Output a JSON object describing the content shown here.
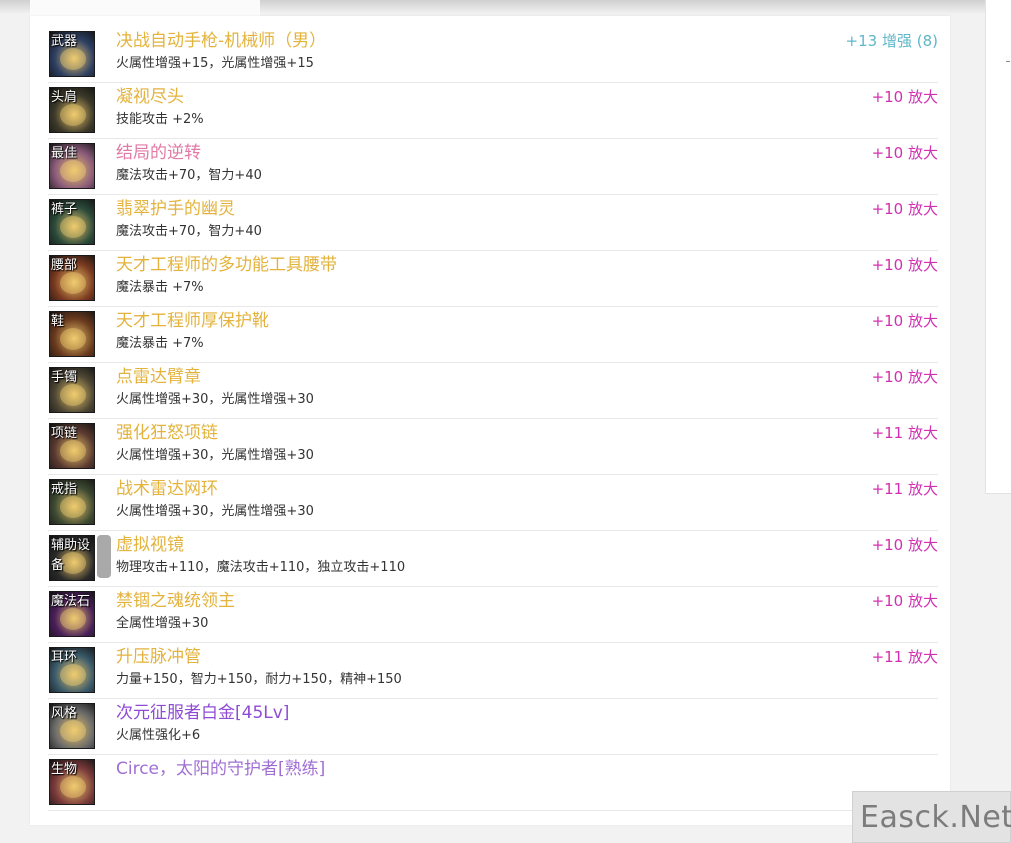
{
  "colors": {
    "gold": "#e3b33c",
    "pink": "#d12fb1",
    "teal": "#5fb7c9",
    "purple": "#8f4bd6",
    "lavender": "#a06fd4"
  },
  "items": [
    {
      "slot": "武器",
      "name": "决战自动手枪-机械师（男）",
      "attr": "火属性增强+15，光属性增强+15",
      "enhance": "+13 增强 (8)",
      "name_color": "#e3b33c",
      "enh_color": "#5fb7c9",
      "icon_color": "#2d3f63"
    },
    {
      "slot": "头肩",
      "name": "凝视尽头",
      "attr": "技能攻击 +2%",
      "enhance": "+10 放大",
      "name_color": "#e3b33c",
      "enh_color": "#d12fb1",
      "icon_color": "#3d3a2a"
    },
    {
      "slot": "最佳",
      "name": "结局的逆转",
      "attr": "魔法攻击+70，智力+40",
      "enhance": "+10 放大",
      "name_color": "#e07aa6",
      "enh_color": "#d12fb1",
      "icon_color": "#8a5a7a"
    },
    {
      "slot": "裤子",
      "name": "翡翠护手的幽灵",
      "attr": "魔法攻击+70，智力+40",
      "enhance": "+10 放大",
      "name_color": "#e3b33c",
      "enh_color": "#d12fb1",
      "icon_color": "#2b4a3a"
    },
    {
      "slot": "腰部",
      "name": "天才工程师的多功能工具腰带",
      "attr": "魔法暴击 +7%",
      "enhance": "+10 放大",
      "name_color": "#e3b33c",
      "enh_color": "#d12fb1",
      "icon_color": "#7a3a20"
    },
    {
      "slot": "鞋",
      "name": "天才工程师厚保护靴",
      "attr": "魔法暴击 +7%",
      "enhance": "+10 放大",
      "name_color": "#e3b33c",
      "enh_color": "#d12fb1",
      "icon_color": "#6a3a1e"
    },
    {
      "slot": "手镯",
      "name": "点雷达臂章",
      "attr": "火属性增强+30，光属性增强+30",
      "enhance": "+10 放大",
      "name_color": "#e3b33c",
      "enh_color": "#d12fb1",
      "icon_color": "#4d4634"
    },
    {
      "slot": "项链",
      "name": "强化狂怒项链",
      "attr": "火属性增强+30，光属性增强+30",
      "enhance": "+11 放大",
      "name_color": "#e3b33c",
      "enh_color": "#d12fb1",
      "icon_color": "#5a3a30"
    },
    {
      "slot": "戒指",
      "name": "战术雷达网环",
      "attr": "火属性增强+30，光属性增强+30",
      "enhance": "+11 放大",
      "name_color": "#e3b33c",
      "enh_color": "#d12fb1",
      "icon_color": "#3e4a32"
    },
    {
      "slot": "辅助设备",
      "name": "虚拟视镜",
      "attr": "物理攻击+110，魔法攻击+110，独立攻击+110",
      "enhance": "+10 放大",
      "name_color": "#e3b33c",
      "enh_color": "#d12fb1",
      "icon_color": "#2a2a2a"
    },
    {
      "slot": "魔法石",
      "name": "禁锢之魂统领主",
      "attr": "全属性增强+30",
      "enhance": "+10 放大",
      "name_color": "#e3b33c",
      "enh_color": "#d12fb1",
      "icon_color": "#4a1f5a"
    },
    {
      "slot": "耳环",
      "name": "升压脉冲管",
      "attr": "力量+150，智力+150，耐力+150，精神+150",
      "enhance": "+11 放大",
      "name_color": "#e3b33c",
      "enh_color": "#d12fb1",
      "icon_color": "#3a5a6a"
    },
    {
      "slot": "风格",
      "name": "次元征服者白金[45Lv]",
      "attr": "火属性强化+6",
      "enhance": "",
      "name_color": "#8f4bd6",
      "enh_color": "#d12fb1",
      "icon_color": "#6a6a6a"
    },
    {
      "slot": "生物",
      "name": "Circe，太阳的守护者[熟练]",
      "attr": "",
      "enhance": "",
      "name_color": "#a06fd4",
      "enh_color": "#d12fb1",
      "icon_color": "#7a3a3a"
    }
  ],
  "watermark": "Easck.Net"
}
